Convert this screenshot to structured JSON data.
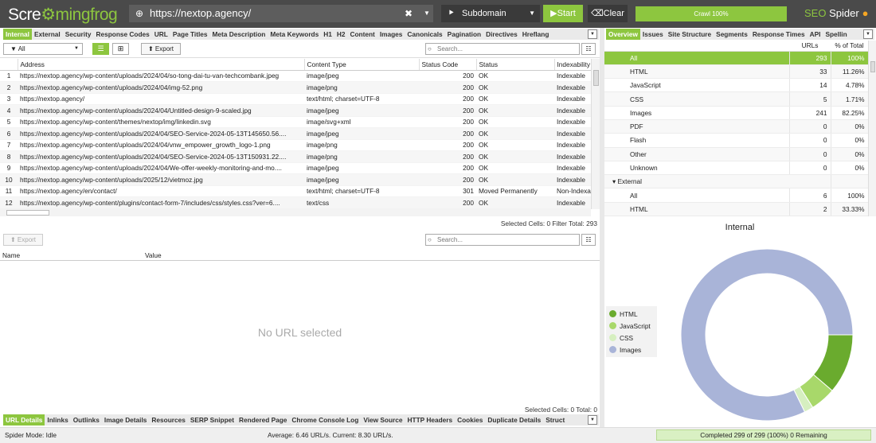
{
  "app": {
    "logo_pre": "Scre",
    "logo_frog": "mingfrog",
    "url": "https://nextop.agency/",
    "mode": "Subdomain",
    "start_label": "Start",
    "clear_label": "Clear",
    "crawl_label": "Crawl 100%",
    "crawl_progress": 1.0,
    "brand_seo": "SEO",
    "brand_spider": "Spider",
    "accent": "#8dc63f"
  },
  "left_tabs": [
    "Internal",
    "External",
    "Security",
    "Response Codes",
    "URL",
    "Page Titles",
    "Meta Description",
    "Meta Keywords",
    "H1",
    "H2",
    "Content",
    "Images",
    "Canonicals",
    "Pagination",
    "Directives",
    "Hreflang"
  ],
  "right_tabs": [
    "Overview",
    "Issues",
    "Site Structure",
    "Segments",
    "Response Times",
    "API",
    "Spellin"
  ],
  "filter": {
    "value": "All",
    "export_label": "Export",
    "search_placeholder": "Search..."
  },
  "grid": {
    "columns": [
      "",
      "Address",
      "Content Type",
      "Status Code",
      "Status",
      "Indexability"
    ],
    "rows": [
      [
        "1",
        "https://nextop.agency/wp-content/uploads/2024/04/so-tong-dai-tu-van-techcombank.jpeg",
        "image/jpeg",
        "200",
        "OK",
        "Indexable"
      ],
      [
        "2",
        "https://nextop.agency/wp-content/uploads/2024/04/img-52.png",
        "image/png",
        "200",
        "OK",
        "Indexable"
      ],
      [
        "3",
        "https://nextop.agency/",
        "text/html; charset=UTF-8",
        "200",
        "OK",
        "Indexable"
      ],
      [
        "4",
        "https://nextop.agency/wp-content/uploads/2024/04/Untitled-design-9-scaled.jpg",
        "image/jpeg",
        "200",
        "OK",
        "Indexable"
      ],
      [
        "5",
        "https://nextop.agency/wp-content/themes/nextop/img/linkedin.svg",
        "image/svg+xml",
        "200",
        "OK",
        "Indexable"
      ],
      [
        "6",
        "https://nextop.agency/wp-content/uploads/2024/04/SEO-Service-2024-05-13T145650.56....",
        "image/jpeg",
        "200",
        "OK",
        "Indexable"
      ],
      [
        "7",
        "https://nextop.agency/wp-content/uploads/2024/04/vnw_empower_growth_logo-1.png",
        "image/png",
        "200",
        "OK",
        "Indexable"
      ],
      [
        "8",
        "https://nextop.agency/wp-content/uploads/2024/04/SEO-Service-2024-05-13T150931.22....",
        "image/png",
        "200",
        "OK",
        "Indexable"
      ],
      [
        "9",
        "https://nextop.agency/wp-content/uploads/2024/04/We-offer-weekly-monitoring-and-mo....",
        "image/jpeg",
        "200",
        "OK",
        "Indexable"
      ],
      [
        "10",
        "https://nextop.agency/wp-content/uploads/2025/12/vietmoz.jpg",
        "image/jpeg",
        "200",
        "OK",
        "Indexable"
      ],
      [
        "11",
        "https://nextop.agency/en/contact/",
        "text/html; charset=UTF-8",
        "301",
        "Moved Permanently",
        "Non-Indexal"
      ],
      [
        "12",
        "https://nextop.agency/wp-content/plugins/contact-form-7/includes/css/styles.css?ver=6....",
        "text/css",
        "200",
        "OK",
        "Indexable"
      ]
    ],
    "selection_info": "Selected Cells:  0  Filter Total:  293"
  },
  "detail": {
    "export_label": "Export",
    "search_placeholder": "Search...",
    "col_name": "Name",
    "col_value": "Value",
    "empty_text": "No URL selected",
    "selection_info": "Selected Cells:  0  Total:  0"
  },
  "bottom_tabs": [
    "URL Details",
    "Inlinks",
    "Outlinks",
    "Image Details",
    "Resources",
    "SERP Snippet",
    "Rendered Page",
    "Chrome Console Log",
    "View Source",
    "HTTP Headers",
    "Cookies",
    "Duplicate Details",
    "Struct"
  ],
  "status": {
    "spider_mode": "Spider Mode: Idle",
    "average": "Average: 6.46 URL/s. Current: 8.30 URL/s.",
    "completed": "Completed 299 of 299 (100%) 0 Remaining"
  },
  "overview": {
    "col_urls": "URLs",
    "col_pct": "% of Total",
    "rows": [
      {
        "label": "All",
        "urls": "293",
        "pct": "100%",
        "selected": true
      },
      {
        "label": "HTML",
        "urls": "33",
        "pct": "11.26%"
      },
      {
        "label": "JavaScript",
        "urls": "14",
        "pct": "4.78%"
      },
      {
        "label": "CSS",
        "urls": "5",
        "pct": "1.71%"
      },
      {
        "label": "Images",
        "urls": "241",
        "pct": "82.25%"
      },
      {
        "label": "PDF",
        "urls": "0",
        "pct": "0%"
      },
      {
        "label": "Flash",
        "urls": "0",
        "pct": "0%"
      },
      {
        "label": "Other",
        "urls": "0",
        "pct": "0%"
      },
      {
        "label": "Unknown",
        "urls": "0",
        "pct": "0%"
      },
      {
        "label": "External",
        "urls": "",
        "pct": "",
        "section": true
      },
      {
        "label": "All",
        "urls": "6",
        "pct": "100%"
      },
      {
        "label": "HTML",
        "urls": "2",
        "pct": "33.33%"
      }
    ]
  },
  "chart_data": {
    "type": "pie",
    "title": "Internal",
    "categories": [
      "HTML",
      "JavaScript",
      "CSS",
      "Images"
    ],
    "values": [
      33,
      14,
      5,
      241
    ],
    "colors": [
      "#6aab2e",
      "#a8d86a",
      "#d6efc0",
      "#a9b4d8"
    ]
  }
}
